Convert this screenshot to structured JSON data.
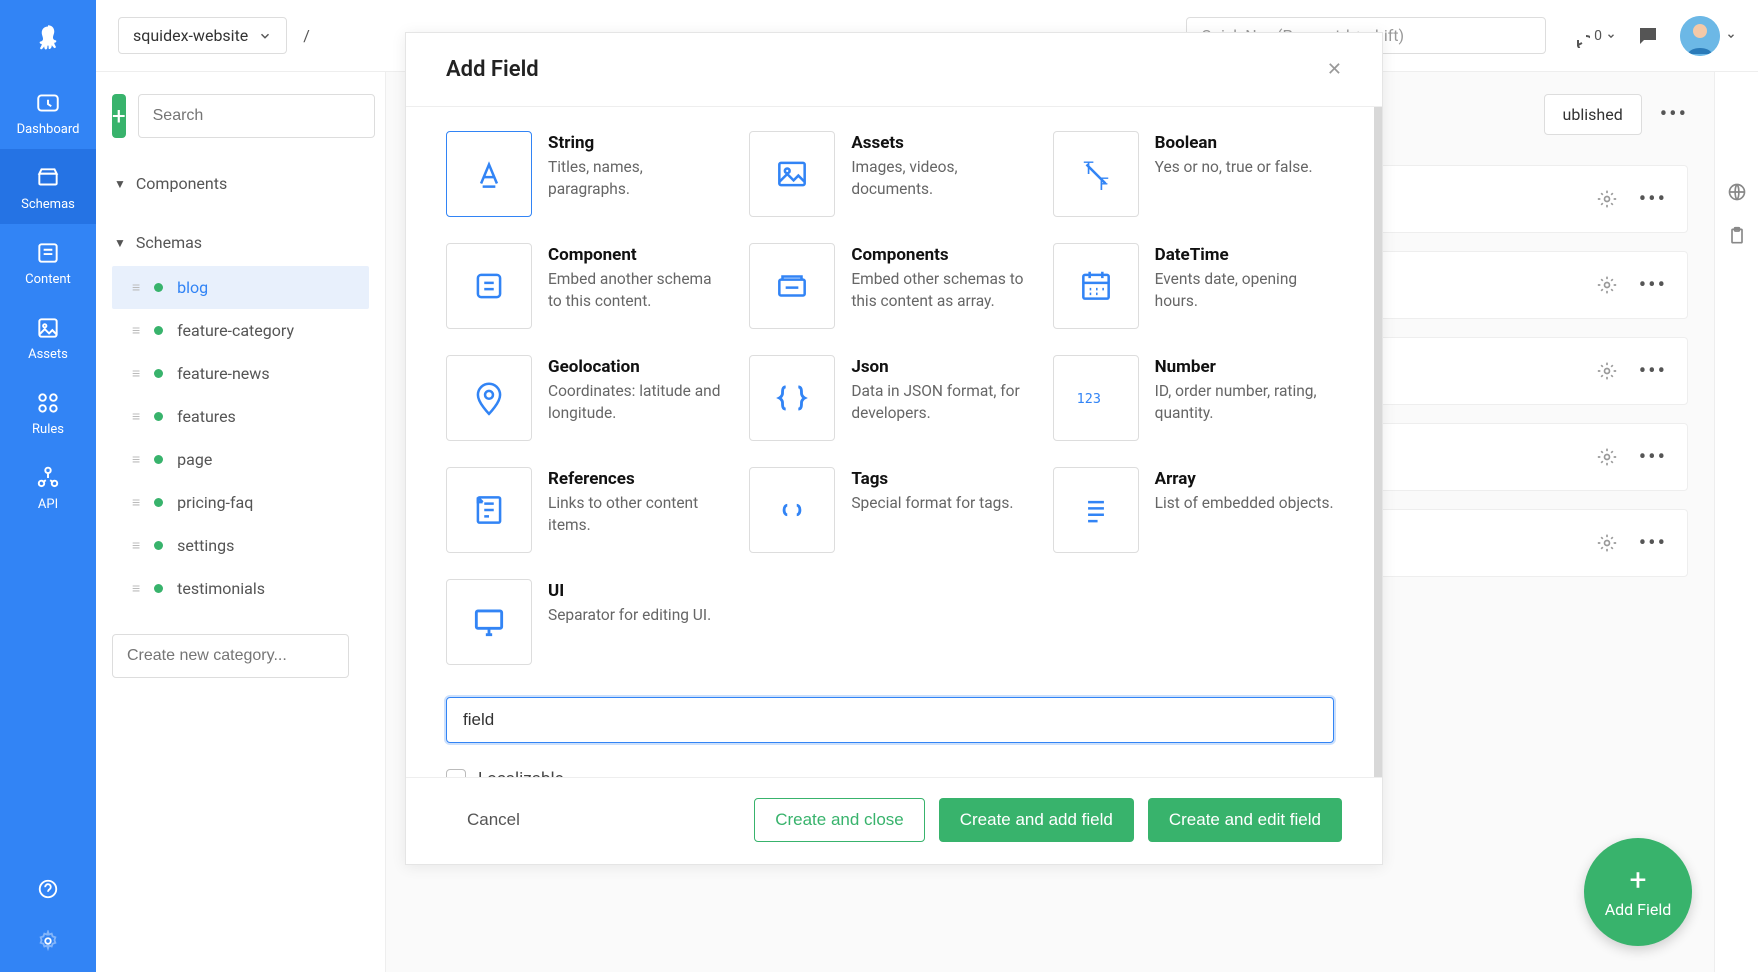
{
  "sidebar": {
    "items": [
      {
        "label": "Dashboard"
      },
      {
        "label": "Schemas"
      },
      {
        "label": "Content"
      },
      {
        "label": "Assets"
      },
      {
        "label": "Rules"
      },
      {
        "label": "API"
      }
    ]
  },
  "topbar": {
    "app_name": "squidex-website",
    "breadcrumb_sep": "/",
    "quick_nav_placeholder": "Quick Nav (Press ctrl + shift)",
    "sync_count": "0"
  },
  "panel": {
    "search_placeholder": "Search",
    "tree_components": "Components",
    "tree_schemas": "Schemas",
    "schemas": [
      {
        "name": "blog"
      },
      {
        "name": "feature-category"
      },
      {
        "name": "feature-news"
      },
      {
        "name": "features"
      },
      {
        "name": "page"
      },
      {
        "name": "pricing-faq"
      },
      {
        "name": "settings"
      },
      {
        "name": "testimonials"
      }
    ],
    "create_category_placeholder": "Create new category..."
  },
  "content": {
    "published_label": "ublished"
  },
  "modal": {
    "title": "Add Field",
    "types": [
      {
        "key": "string",
        "title": "String",
        "desc": "Titles, names, paragraphs."
      },
      {
        "key": "assets",
        "title": "Assets",
        "desc": "Images, videos, documents."
      },
      {
        "key": "boolean",
        "title": "Boolean",
        "desc": "Yes or no, true or false."
      },
      {
        "key": "component",
        "title": "Component",
        "desc": "Embed another schema to this content."
      },
      {
        "key": "components",
        "title": "Components",
        "desc": "Embed other schemas to this content as array."
      },
      {
        "key": "datetime",
        "title": "DateTime",
        "desc": "Events date, opening hours."
      },
      {
        "key": "geolocation",
        "title": "Geolocation",
        "desc": "Coordinates: latitude and longitude."
      },
      {
        "key": "json",
        "title": "Json",
        "desc": "Data in JSON format, for developers."
      },
      {
        "key": "number",
        "title": "Number",
        "desc": "ID, order number, rating, quantity."
      },
      {
        "key": "references",
        "title": "References",
        "desc": "Links to other content items."
      },
      {
        "key": "tags",
        "title": "Tags",
        "desc": "Special format for tags."
      },
      {
        "key": "array",
        "title": "Array",
        "desc": "List of embedded objects."
      },
      {
        "key": "ui",
        "title": "UI",
        "desc": "Separator for editing UI."
      }
    ],
    "field_name_value": "field",
    "localizable_label": "Localizable",
    "cancel": "Cancel",
    "create_close": "Create and close",
    "create_add": "Create and add field",
    "create_edit": "Create and edit field"
  },
  "fab": {
    "label": "Add Field"
  }
}
